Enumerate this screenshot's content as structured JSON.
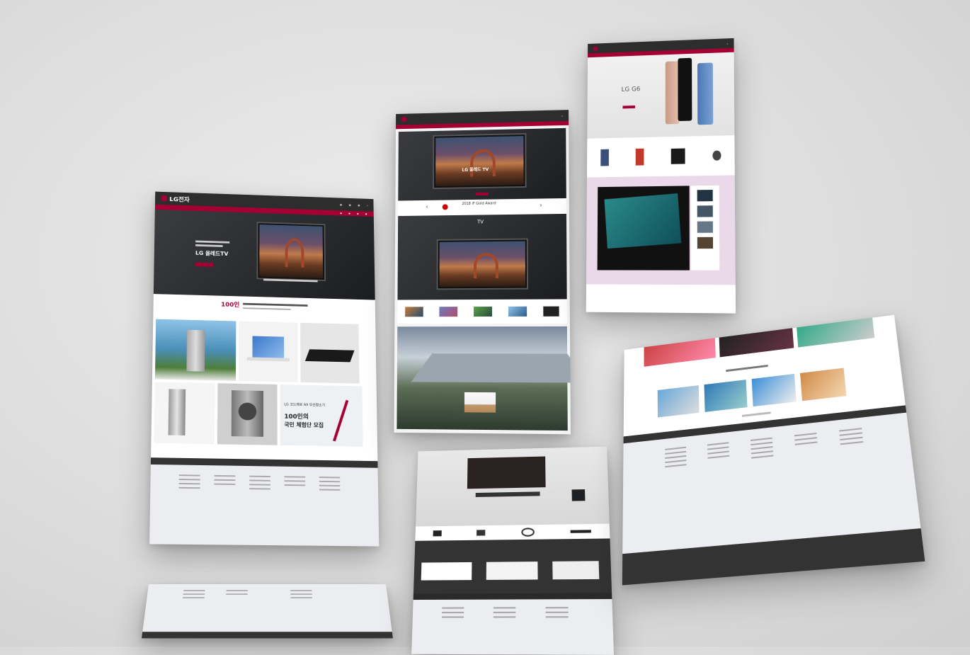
{
  "mockup": {
    "center": {
      "award_title": "2018 iF Gold Award",
      "hero_title": "LG 올레드 TV",
      "tv_section_title": "TV"
    },
    "left": {
      "logo_text": "LG전자",
      "hero_title": "LG 올레드TV",
      "promo_badge": "100인",
      "banner_line1": "LG 코드제로 A9 무선청소기",
      "banner_line2": "100인의",
      "banner_line3": "국민 체험단 모집"
    },
    "right": {
      "phone_title": "LG G6"
    }
  },
  "colors": {
    "brand_red": "#a50034",
    "nav_dark": "#2d2d2d",
    "footer_dark": "#333333",
    "footer_light": "#ecedf0"
  }
}
